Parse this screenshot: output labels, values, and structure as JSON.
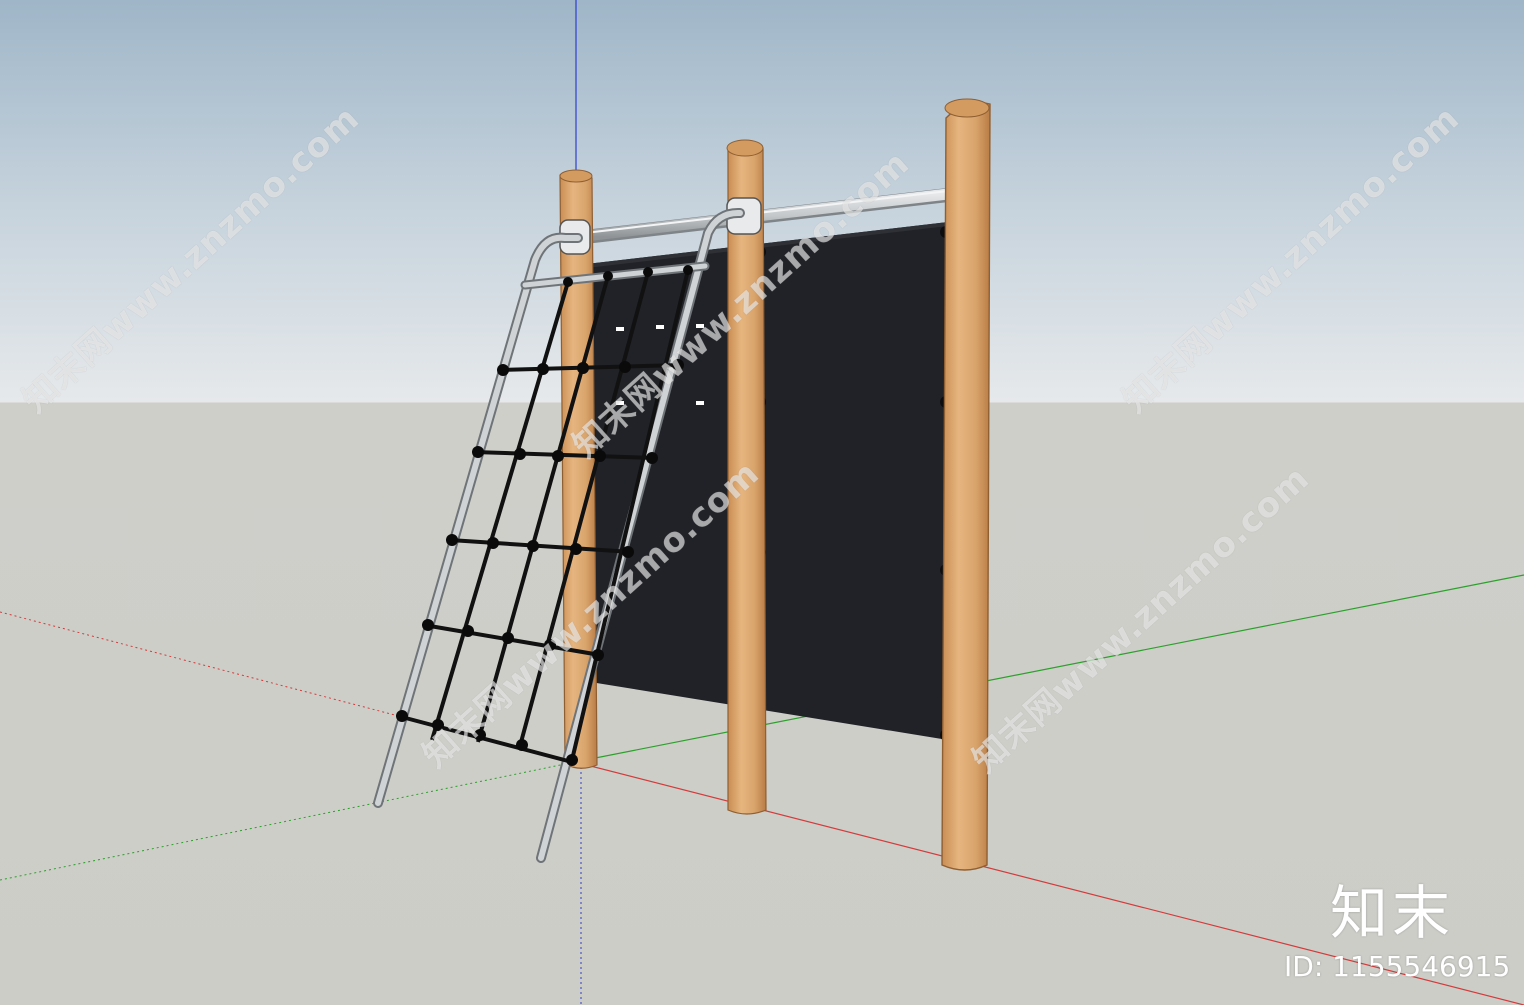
{
  "watermark": {
    "site_text": "知末网www.znzmo.com"
  },
  "brand": {
    "logo_text": "知末",
    "id_text": "ID: 1155546915"
  },
  "colors": {
    "sky_top": "#9fb6c8",
    "ground": "#cdcdc8",
    "panel": "#202227",
    "wood": "#d9a46c",
    "wood_shadow": "#b97c45",
    "pipe": "#c8cbcd",
    "net": "#111111",
    "axis_red": "#d23c3c",
    "axis_green": "#2ca02c",
    "axis_blue": "#2d3fd0"
  },
  "scene_objects": {
    "climbing_net_icon": "climbing-net",
    "panel_icon": "black-panel",
    "post_icons": [
      "wooden-post",
      "wooden-post",
      "wooden-post"
    ]
  }
}
